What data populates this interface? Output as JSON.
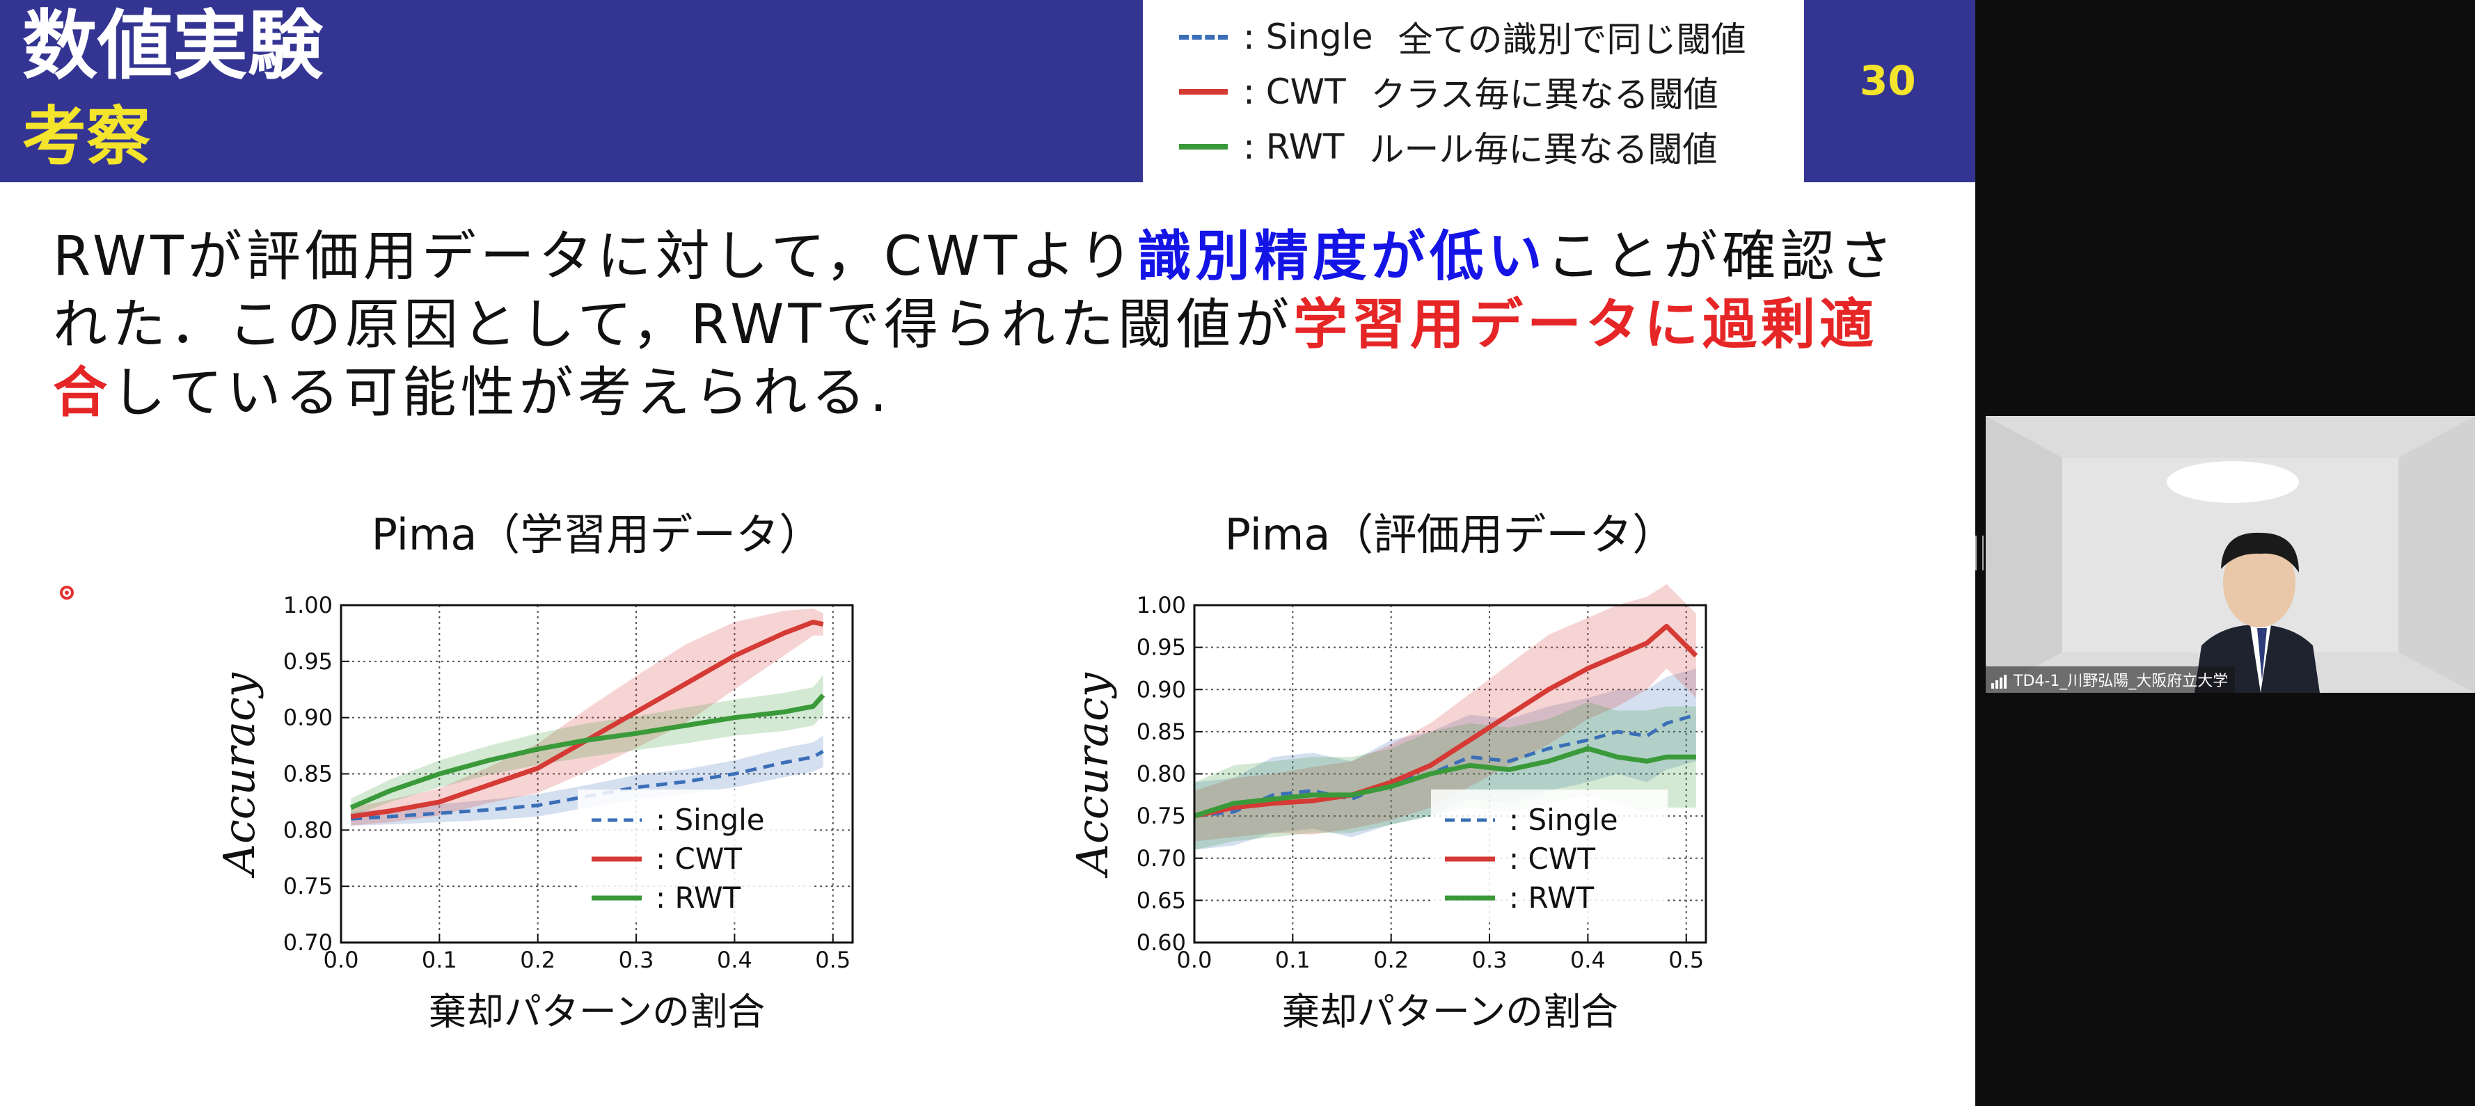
{
  "slide": {
    "title": "数値実験",
    "subtitle": "考察",
    "page_number": "30",
    "legend": [
      {
        "label": ": Single",
        "desc": "全ての識別で同じ閾値",
        "color": "#3a6fb8",
        "style": "dashed"
      },
      {
        "label": ": CWT",
        "desc": "クラス毎に異なる閾値",
        "color": "#d53a35",
        "style": "solid"
      },
      {
        "label": ": RWT",
        "desc": "ルール毎に異なる閾値",
        "color": "#3a9a3a",
        "style": "solid"
      }
    ],
    "paragraph": {
      "p1": "RWTが評価用データに対して，CWTより",
      "p2": "識別精度が低い",
      "p3": "ことが確認された．この原因として，RWTで得られた閾値が",
      "p4": "学習用データに過剰適合",
      "p5": "している可能性が考えられる."
    }
  },
  "chart_data": [
    {
      "type": "line",
      "title": "Pima（学習用データ）",
      "xlabel": "棄却パターンの割合",
      "ylabel": "Accuracy",
      "xlim": [
        0.0,
        0.52
      ],
      "ylim": [
        0.7,
        1.0
      ],
      "xticks": [
        "0.0",
        "0.1",
        "0.2",
        "0.3",
        "0.4",
        "0.5"
      ],
      "yticks": [
        "0.70",
        "0.75",
        "0.80",
        "0.85",
        "0.90",
        "0.95",
        "1.00"
      ],
      "grid": true,
      "legend_position": "lower-right",
      "x": [
        0.01,
        0.05,
        0.1,
        0.15,
        0.2,
        0.25,
        0.3,
        0.35,
        0.4,
        0.45,
        0.48,
        0.49
      ],
      "series": [
        {
          "name": ": Single",
          "color": "#3a6fb8",
          "style": "dashed",
          "values": [
            0.81,
            0.812,
            0.815,
            0.818,
            0.822,
            0.83,
            0.838,
            0.843,
            0.85,
            0.86,
            0.865,
            0.87
          ],
          "band": [
            0.006,
            0.007,
            0.008,
            0.009,
            0.01,
            0.01,
            0.011,
            0.011,
            0.012,
            0.013,
            0.013,
            0.014
          ]
        },
        {
          "name": ": CWT",
          "color": "#d53a35",
          "style": "solid",
          "values": [
            0.812,
            0.817,
            0.825,
            0.84,
            0.855,
            0.88,
            0.905,
            0.93,
            0.955,
            0.975,
            0.985,
            0.983
          ],
          "band": [
            0.008,
            0.01,
            0.012,
            0.016,
            0.022,
            0.028,
            0.032,
            0.035,
            0.03,
            0.02,
            0.012,
            0.01
          ]
        },
        {
          "name": ": RWT",
          "color": "#3a9a3a",
          "style": "solid",
          "values": [
            0.82,
            0.835,
            0.85,
            0.862,
            0.872,
            0.88,
            0.886,
            0.893,
            0.9,
            0.905,
            0.91,
            0.92
          ],
          "band": [
            0.008,
            0.01,
            0.012,
            0.013,
            0.014,
            0.015,
            0.015,
            0.016,
            0.016,
            0.017,
            0.017,
            0.018
          ]
        }
      ]
    },
    {
      "type": "line",
      "title": "Pima（評価用データ）",
      "xlabel": "棄却パターンの割合",
      "ylabel": "Accuracy",
      "xlim": [
        0.0,
        0.52
      ],
      "ylim": [
        0.6,
        1.0
      ],
      "xticks": [
        "0.0",
        "0.1",
        "0.2",
        "0.3",
        "0.4",
        "0.5"
      ],
      "yticks": [
        "0.60",
        "0.65",
        "0.70",
        "0.75",
        "0.80",
        "0.85",
        "0.90",
        "0.95",
        "1.00"
      ],
      "grid": true,
      "legend_position": "lower-right",
      "x": [
        0.0,
        0.04,
        0.08,
        0.12,
        0.16,
        0.2,
        0.24,
        0.28,
        0.32,
        0.36,
        0.4,
        0.43,
        0.46,
        0.48,
        0.51
      ],
      "series": [
        {
          "name": ": Single",
          "color": "#3a6fb8",
          "style": "dashed",
          "values": [
            0.75,
            0.755,
            0.775,
            0.78,
            0.77,
            0.79,
            0.8,
            0.82,
            0.815,
            0.83,
            0.84,
            0.85,
            0.845,
            0.86,
            0.87
          ],
          "band": [
            0.04,
            0.04,
            0.045,
            0.045,
            0.045,
            0.05,
            0.05,
            0.05,
            0.05,
            0.05,
            0.05,
            0.05,
            0.055,
            0.055,
            0.055
          ]
        },
        {
          "name": ": CWT",
          "color": "#d53a35",
          "style": "solid",
          "values": [
            0.75,
            0.76,
            0.765,
            0.768,
            0.775,
            0.79,
            0.81,
            0.84,
            0.87,
            0.9,
            0.925,
            0.94,
            0.955,
            0.975,
            0.94
          ],
          "band": [
            0.03,
            0.035,
            0.035,
            0.04,
            0.04,
            0.045,
            0.05,
            0.055,
            0.06,
            0.065,
            0.06,
            0.06,
            0.055,
            0.05,
            0.05
          ]
        },
        {
          "name": ": RWT",
          "color": "#3a9a3a",
          "style": "solid",
          "values": [
            0.75,
            0.765,
            0.77,
            0.775,
            0.775,
            0.785,
            0.8,
            0.81,
            0.805,
            0.815,
            0.83,
            0.82,
            0.815,
            0.82,
            0.82
          ],
          "band": [
            0.04,
            0.045,
            0.045,
            0.045,
            0.045,
            0.045,
            0.05,
            0.05,
            0.05,
            0.05,
            0.055,
            0.055,
            0.06,
            0.06,
            0.06
          ]
        }
      ]
    }
  ],
  "webcam": {
    "participant_label": "TD4-1_川野弘陽_大阪府立大学"
  }
}
